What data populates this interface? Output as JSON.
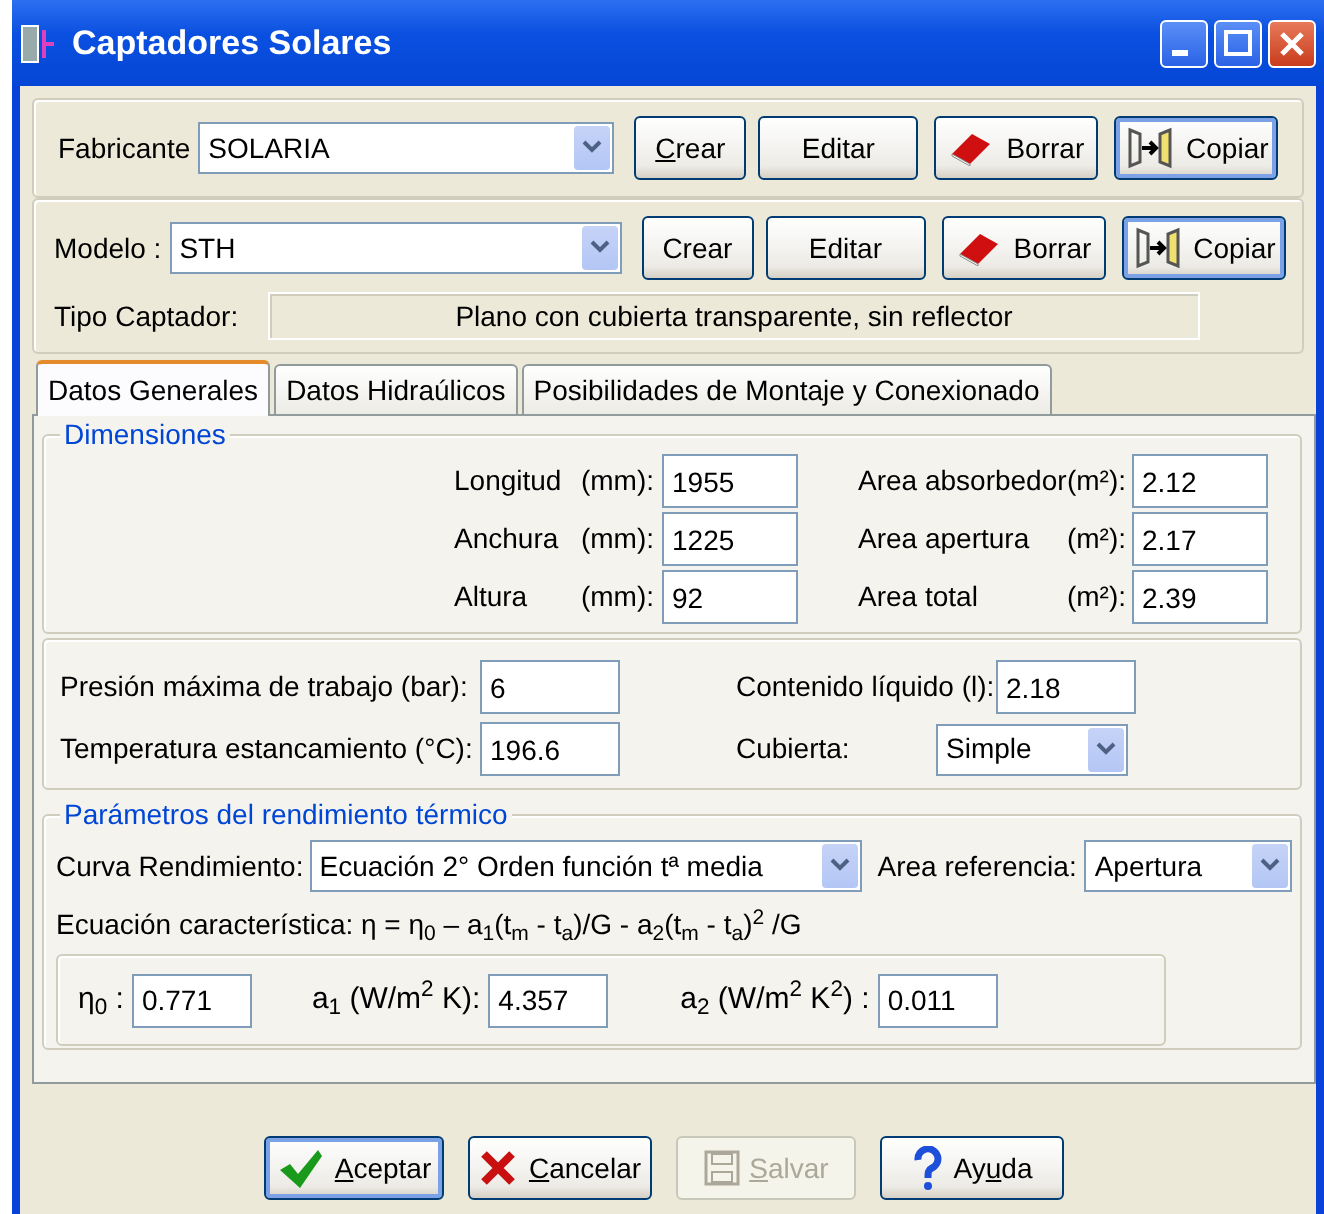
{
  "window": {
    "title": "Captadores Solares"
  },
  "fabricante": {
    "label": "Fabricante",
    "value": "SOLARIA",
    "buttons": [
      {
        "kind": "plain",
        "label": {
          "key": "C",
          "post": "rear"
        },
        "highlighted": false
      },
      {
        "kind": "plain",
        "label": "Editar",
        "highlighted": false
      },
      {
        "kind": "delete",
        "label": "Borrar",
        "highlighted": false
      },
      {
        "kind": "copy",
        "label": "Copiar",
        "highlighted": true
      }
    ]
  },
  "modelo": {
    "label": "Modelo :",
    "value": "STH",
    "buttons": [
      {
        "kind": "plain",
        "label": "Crear",
        "highlighted": false
      },
      {
        "kind": "plain",
        "label": "Editar",
        "highlighted": false
      },
      {
        "kind": "delete",
        "label": "Borrar",
        "highlighted": false
      },
      {
        "kind": "copy",
        "label": "Copiar",
        "highlighted": true
      }
    ],
    "tipo_label": "Tipo Captador:",
    "tipo_value": "Plano con cubierta transparente, sin reflector"
  },
  "tabs": [
    {
      "label": "Datos Generales",
      "selected": true
    },
    {
      "label": "Datos Hidraúlicos",
      "selected": false
    },
    {
      "label": "Posibilidades de Montaje y Conexionado",
      "selected": false
    }
  ],
  "dimensiones": {
    "title": "Dimensiones",
    "rows": [
      {
        "left": {
          "label": "Longitud",
          "unit": "(mm):",
          "value": "1955"
        },
        "right": {
          "label": "Area absorbedor",
          "unit": "(m²):",
          "value": "2.12"
        }
      },
      {
        "left": {
          "label": "Anchura",
          "unit": "(mm):",
          "value": "1225"
        },
        "right": {
          "label": "Area apertura",
          "unit": "(m²):",
          "value": "2.17"
        }
      },
      {
        "left": {
          "label": "Altura",
          "unit": "(mm):",
          "value": "92"
        },
        "right": {
          "label": "Area total",
          "unit": "(m²):",
          "value": "2.39"
        }
      }
    ]
  },
  "otros": {
    "rows": [
      {
        "left": {
          "label": "Presión máxima de trabajo (bar):",
          "value": "6",
          "kind": "input"
        },
        "right": {
          "label": "Contenido líquido (l):",
          "value": "2.18",
          "kind": "input"
        }
      },
      {
        "left": {
          "label": "Temperatura estancamiento (°C):",
          "value": "196.6",
          "kind": "input"
        },
        "right": {
          "label": "Cubierta:",
          "value": "Simple",
          "kind": "select"
        }
      }
    ]
  },
  "rendimiento": {
    "title": "Parámetros del rendimiento térmico",
    "curva_label": "Curva Rendimiento:",
    "curva_value": "Ecuación 2° Orden función tª media",
    "area_label": "Area referencia:",
    "area_value": "Apertura",
    "equation": "Ecuación característica: η = η$_{0}$ – a$_{1}$(t$_{m}$ - t$_{a}$)/G - a$_{2}$(t$_{m}$ - t$_{a}$)$^{2}$ /G",
    "coefficients": [
      {
        "label": "η$_{0}$ :",
        "value": "0.771"
      },
      {
        "label": "a$_{1}$ (W/m$^{2}$ K):",
        "value": "4.357"
      },
      {
        "label": "a$_{2}$ (W/m$^{2}$ K$^{2}$) :",
        "value": "0.011"
      }
    ]
  },
  "footer_buttons": [
    {
      "kind": "accept",
      "label": {
        "key": "A",
        "post": "ceptar"
      },
      "highlighted": true,
      "disabled": false
    },
    {
      "kind": "cancel",
      "label": {
        "key": "C",
        "post": "ancelar"
      },
      "highlighted": false,
      "disabled": false
    },
    {
      "kind": "save",
      "label": {
        "key": "S",
        "post": "alvar"
      },
      "highlighted": false,
      "disabled": true
    },
    {
      "kind": "help",
      "label": {
        "pre": "Ay",
        "key": "u",
        "post": "da"
      },
      "highlighted": false,
      "disabled": false
    }
  ]
}
